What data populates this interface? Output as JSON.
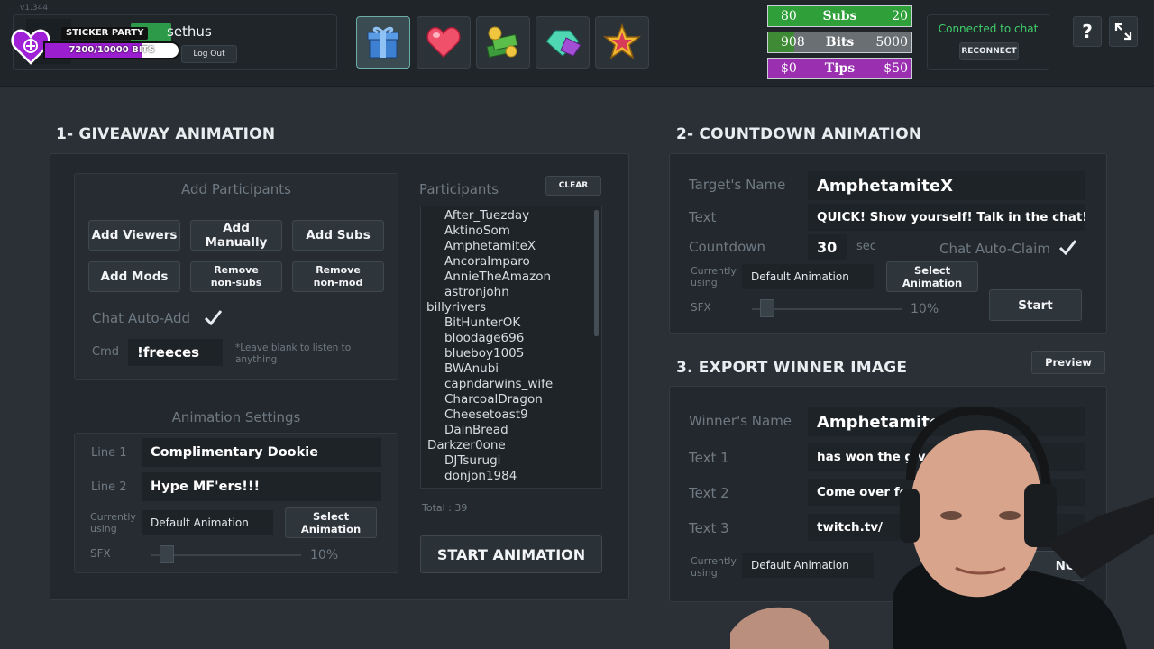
{
  "header": {
    "version": "v1.344",
    "username": "sethus",
    "logout_label": "Log Out",
    "sticker_party": {
      "title": "STICKER PARTY",
      "progress_text": "7200/10000 BITS",
      "progress": 0.72
    },
    "tools": [
      {
        "icon": "gift-icon",
        "active": true
      },
      {
        "icon": "heart-icon",
        "active": false
      },
      {
        "icon": "money-stack-icon",
        "active": false
      },
      {
        "icon": "gem-icon",
        "active": false
      },
      {
        "icon": "star-badge-icon",
        "active": false
      }
    ],
    "goals": [
      {
        "left": "80",
        "label": "Subs",
        "right": "20",
        "color": "#2f9f3a",
        "progress": 1.0
      },
      {
        "left": "908",
        "label": "Bits",
        "right": "5000",
        "color": "#3f8a34",
        "progress": 0.18
      },
      {
        "left": "$0",
        "label": "Tips",
        "right": "$50",
        "color": "#9a2fb0",
        "progress": 1.0
      }
    ],
    "chat_status": "Connected to chat",
    "reconnect_label": "RECONNECT",
    "help_icon": "help-icon",
    "fullscreen_icon": "fullscreen-icon"
  },
  "giveaway": {
    "title": "1- GIVEAWAY ANIMATION",
    "add_participants_title": "Add Participants",
    "buttons": {
      "add_viewers": "Add Viewers",
      "add_manually": "Add Manually",
      "add_subs": "Add Subs",
      "add_mods": "Add Mods",
      "remove_nonsubs": "Remove\nnon-subs",
      "remove_nonmod": "Remove\nnon-mod"
    },
    "chat_auto_add_label": "Chat Auto-Add",
    "cmd_label": "Cmd",
    "cmd_value": "!freeces",
    "cmd_hint": "*Leave blank to listen to anything",
    "animation_settings_title": "Animation Settings",
    "line1_label": "Line 1",
    "line1_value": "Complimentary Dookie",
    "line2_label": "Line 2",
    "line2_value": "Hype MF'ers!!!",
    "currently_using_label": "Currently using",
    "current_animation": "Default Animation",
    "select_animation_label": "Select Animation",
    "sfx_label": "SFX",
    "sfx_value": "10%",
    "sfx_level": 0.1,
    "participants_title": "Participants",
    "clear_label": "CLEAR",
    "participants": [
      "After_Tuezday",
      "AktinoSom",
      "AmphetamiteX",
      "AncoraImparo",
      "AnnieTheAmazon",
      "astronjohn",
      "billyrivers",
      "BitHunterOK",
      "bloodage696",
      "blueboy1005",
      "BWAnubi",
      "capndarwins_wife",
      "CharcoalDragon",
      "Cheesetoast9",
      "DainBread",
      "Darkzer0one",
      "DJTsurugi",
      "donjon1984"
    ],
    "total_label": "Total : 39",
    "start_label": "START ANIMATION"
  },
  "countdown": {
    "title": "2- COUNTDOWN ANIMATION",
    "target_label": "Target's Name",
    "target_value": "AmphetamiteX",
    "text_label": "Text",
    "text_value": "QUICK!  Show yourself!  Talk in the chat!",
    "countdown_label": "Countdown",
    "countdown_value": "30",
    "countdown_unit": "sec",
    "chat_auto_claim_label": "Chat Auto-Claim",
    "currently_using_label": "Currently using",
    "current_animation": "Default Animation",
    "select_animation_label": "Select Animation",
    "sfx_label": "SFX",
    "sfx_value": "10%",
    "sfx_level": 0.1,
    "start_label": "Start"
  },
  "export": {
    "title": "3. EXPORT WINNER IMAGE",
    "preview_label": "Preview",
    "winner_label": "Winner's Name",
    "winner_value": "Amphetamite",
    "text1_label": "Text 1",
    "text1_value": "has won the giv",
    "text2_label": "Text 2",
    "text2_value": "Come over for",
    "text3_label": "Text 3",
    "text3_value": "twitch.tv/",
    "currently_using_label": "Currently using",
    "current_animation": "Default Animation",
    "save_label": "NG"
  }
}
